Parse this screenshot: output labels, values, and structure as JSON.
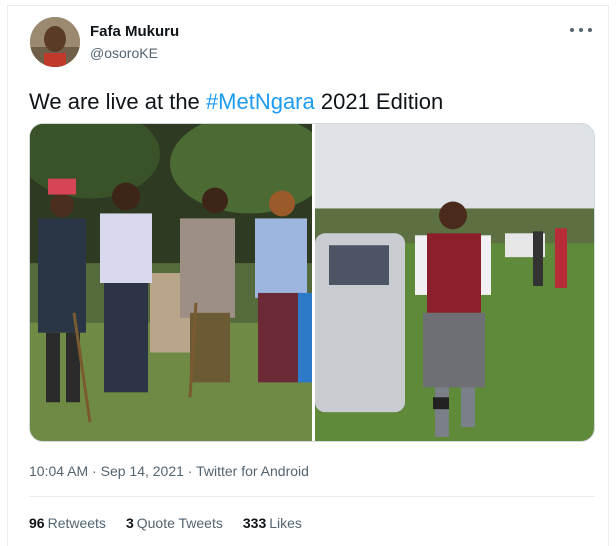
{
  "author": {
    "display_name": "Fafa Mukuru",
    "handle": "@osoroKE"
  },
  "tweet": {
    "text_before": "We are live at the ",
    "hashtag": "#MetNgara",
    "text_after": " 2021 Edition"
  },
  "meta": {
    "time": "10:04 AM",
    "separator": " · ",
    "date": "Sep 14, 2021",
    "separator2": " · ",
    "source": "Twitter for Android"
  },
  "stats": {
    "retweets_count": "96",
    "retweets_label": "Retweets",
    "quotes_count": "3",
    "quotes_label": "Quote Tweets",
    "likes_count": "333",
    "likes_label": "Likes"
  },
  "colors": {
    "accent": "#1d9bf0",
    "muted": "#536471",
    "text": "#0f1419"
  },
  "icons": {
    "more": "more-horizontal-icon"
  }
}
